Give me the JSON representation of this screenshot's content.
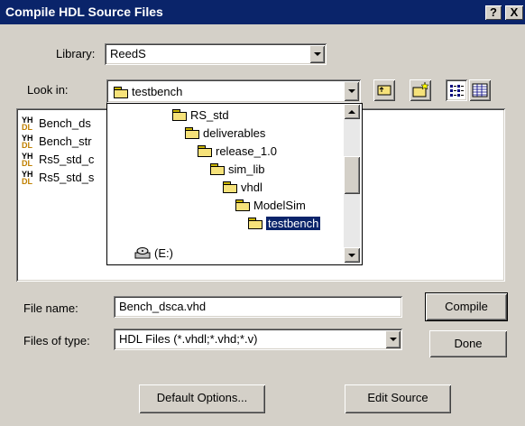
{
  "window": {
    "title": "Compile HDL Source Files",
    "help_button": "?",
    "close_button": "X"
  },
  "library": {
    "label": "Library:",
    "value": "ReedS"
  },
  "look_in": {
    "label": "Look in:",
    "value": "testbench"
  },
  "files": [
    {
      "name": "Bench_ds"
    },
    {
      "name": "Bench_str"
    },
    {
      "name": "Rs5_std_c"
    },
    {
      "name": "Rs5_std_s"
    }
  ],
  "folder_tree": [
    {
      "label": "RS_std"
    },
    {
      "label": "deliverables"
    },
    {
      "label": "release_1.0"
    },
    {
      "label": "sim_lib"
    },
    {
      "label": "vhdl"
    },
    {
      "label": "ModelSim"
    },
    {
      "label": "testbench",
      "selected": true
    },
    {
      "label": "(E:)"
    }
  ],
  "file_name": {
    "label": "File name:",
    "value": "Bench_dsca.vhd"
  },
  "files_of_type": {
    "label": "Files of type:",
    "value": "HDL Files (*.vhdl;*.vhd;*.v)"
  },
  "buttons": {
    "compile": "Compile",
    "done": "Done",
    "default_options": "Default Options...",
    "edit_source": "Edit Source"
  },
  "colors": {
    "titlebar": "#0a246a",
    "face": "#d4d0c8",
    "selection": "#0a246a"
  }
}
